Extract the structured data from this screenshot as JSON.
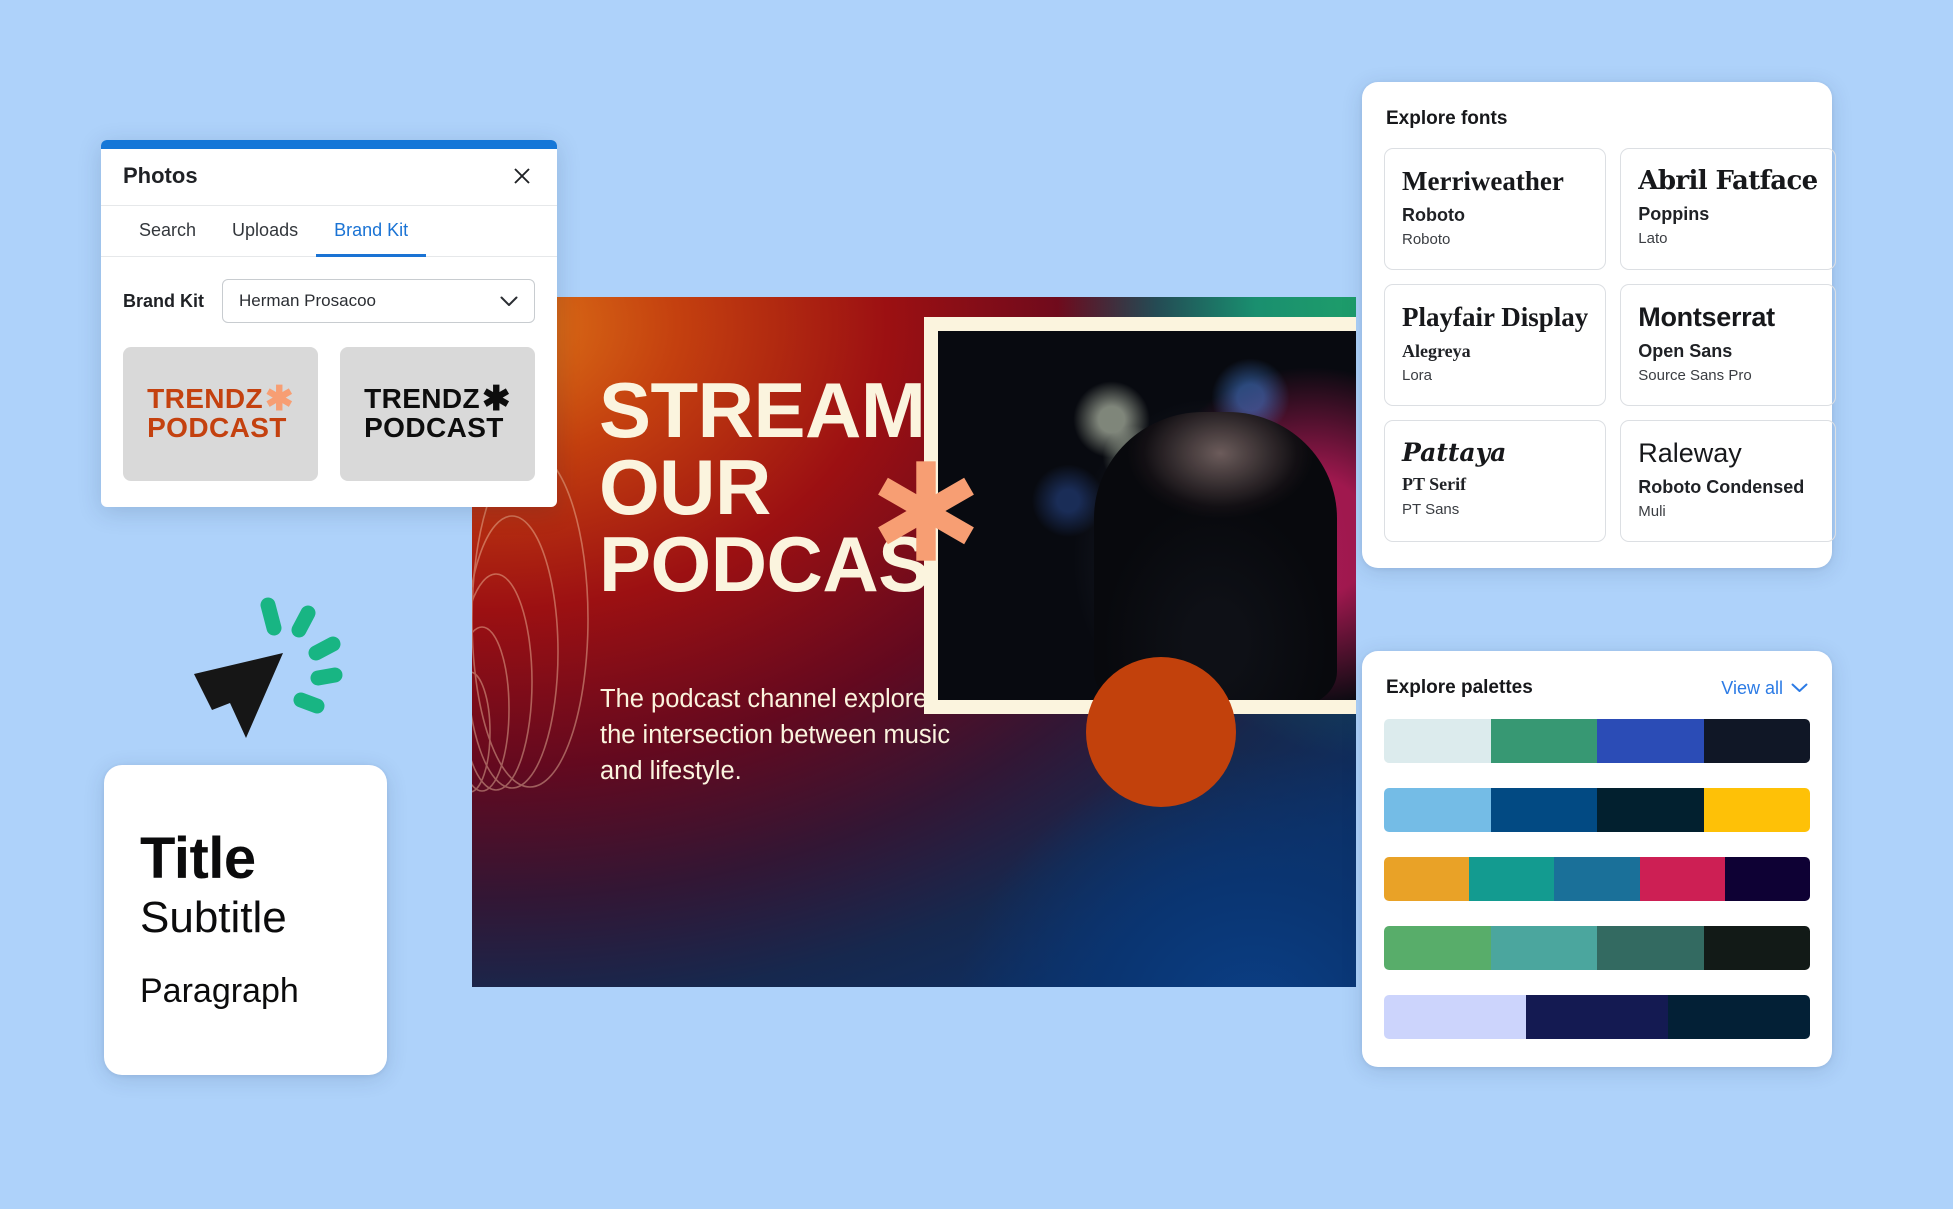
{
  "background_color": "#aed2fa",
  "photos_panel": {
    "title": "Photos",
    "accent_color": "#1577d8",
    "close_icon": "close-icon",
    "tabs": [
      {
        "label": "Search",
        "active": false
      },
      {
        "label": "Uploads",
        "active": false
      },
      {
        "label": "Brand Kit",
        "active": true
      }
    ],
    "brand_kit_label": "Brand Kit",
    "brand_kit_selected": "Herman Prosacoo",
    "dropdown_icon": "chevron-down-icon",
    "logos": [
      {
        "line1": "TRENDZ",
        "star": "✱",
        "line2": "PODCAST",
        "text_color": "#c4410f",
        "star_color": "#f79e73"
      },
      {
        "line1": "TRENDZ",
        "star": "✱",
        "line2": "PODCAST",
        "text_color": "#0d0d0d",
        "star_color": "#0d0d0d"
      }
    ]
  },
  "poster": {
    "headline_lines": [
      "STREAM",
      "OUR",
      "PODCAST"
    ],
    "subtitle": "The podcast channel explores the intersection between music and lifestyle.",
    "text_color": "#fbf4de",
    "asterisk_color": "#f79e73",
    "circle_color": "#c2410c",
    "frame_color": "#fbf4de"
  },
  "typography_card": {
    "title": "Title",
    "subtitle": "Subtitle",
    "paragraph": "Paragraph"
  },
  "cursor": {
    "arrow_color": "#161616",
    "burst_color": "#18b583"
  },
  "fonts_panel": {
    "title": "Explore fonts",
    "cards": [
      {
        "primary": "Merriweather",
        "secondary": "Roboto",
        "tertiary": "Roboto",
        "style": "serif"
      },
      {
        "primary": "Abril Fatface",
        "secondary": "Poppins",
        "tertiary": "Lato",
        "style": "slab"
      },
      {
        "primary": "Playfair Display",
        "secondary": "Alegreya",
        "tertiary": "Lora",
        "style": "serif"
      },
      {
        "primary": "Montserrat",
        "secondary": "Open Sans",
        "tertiary": "Source Sans Pro",
        "style": "sans"
      },
      {
        "primary": "Pattaya",
        "secondary": "PT Serif",
        "tertiary": "PT Sans",
        "style": "script"
      },
      {
        "primary": "Raleway",
        "secondary": "Roboto Condensed",
        "tertiary": "Muli",
        "style": "light"
      }
    ]
  },
  "palettes_panel": {
    "title": "Explore palettes",
    "view_all_label": "View all",
    "view_all_icon": "chevron-down-icon",
    "palettes": [
      {
        "colors": [
          "#dcebed",
          "#379873",
          "#2b4cb6",
          "#101726"
        ]
      },
      {
        "colors": [
          "#74bce6",
          "#024a83",
          "#02202f",
          "#fec107"
        ]
      },
      {
        "colors": [
          "#e9a227",
          "#139b90",
          "#1a7099",
          "#cd1f54",
          "#0e0134"
        ]
      },
      {
        "colors": [
          "#58ad6a",
          "#4ba69e",
          "#336a61",
          "#121a17"
        ]
      },
      {
        "colors": [
          "#ccd4fc",
          "#141a52",
          "#032036"
        ]
      }
    ]
  }
}
